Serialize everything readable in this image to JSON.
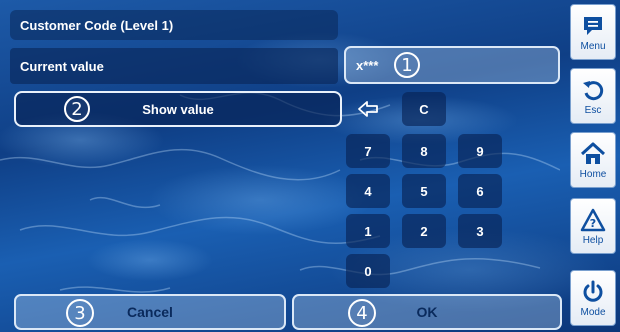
{
  "title": "Customer Code (Level 1)",
  "current_value_label": "Current value",
  "current_value": "x***",
  "show_button_label": "Show value",
  "callouts": {
    "value": "1",
    "show": "2",
    "cancel": "3",
    "ok": "4"
  },
  "keypad": {
    "backspace_icon": "backspace-arrow-icon",
    "clear": "C",
    "row1": [
      "7",
      "8",
      "9"
    ],
    "row2": [
      "4",
      "5",
      "6"
    ],
    "row3": [
      "1",
      "2",
      "3"
    ],
    "zero": "0"
  },
  "buttons": {
    "cancel": "Cancel",
    "ok": "OK"
  },
  "side_menu": [
    {
      "label": "Menu",
      "icon": "speech-bubble-icon"
    },
    {
      "label": "Esc",
      "icon": "undo-arrow-icon"
    },
    {
      "label": "Home",
      "icon": "house-icon"
    },
    {
      "label": "Help",
      "icon": "warning-triangle-icon"
    },
    {
      "label": "Mode",
      "icon": "power-icon"
    }
  ],
  "colors": {
    "accent": "#0e4fa0",
    "panel": "#0b2f6b"
  }
}
